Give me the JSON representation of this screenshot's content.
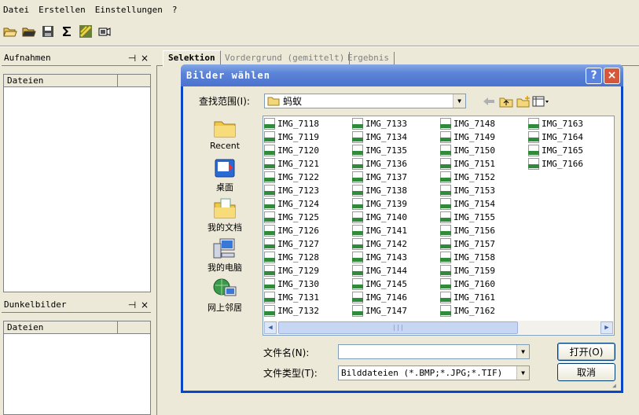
{
  "menu": [
    "Datei",
    "Erstellen",
    "Einstellungen",
    "?"
  ],
  "toolbar": {
    "icons": [
      "open-folder-icon",
      "open-folder-2-icon",
      "save-icon",
      "sigma-icon",
      "image-process-icon",
      "camera-icon"
    ]
  },
  "panels": {
    "top": {
      "title": "Aufnahmen",
      "pin": "ᵖ",
      "close": "×",
      "column": "Dateien"
    },
    "bottom": {
      "title": "Dunkelbilder",
      "pin": "ᵖ",
      "close": "×",
      "column": "Dateien"
    }
  },
  "tabs": [
    {
      "label": "Selektion",
      "active": true
    },
    {
      "label": "Vordergrund (gemittelt)",
      "active": false
    },
    {
      "label": "Ergebnis",
      "active": false
    }
  ],
  "dialog": {
    "title": "Bilder wählen",
    "help": "?",
    "close": "×",
    "lookin_label": "查找范围(I):",
    "lookin_value": "蚂蚁",
    "places": [
      {
        "label": "Recent",
        "icon": "recent-folder-icon"
      },
      {
        "label": "桌面",
        "icon": "desktop-icon"
      },
      {
        "label": "我的文档",
        "icon": "my-documents-icon"
      },
      {
        "label": "我的电脑",
        "icon": "my-computer-icon"
      },
      {
        "label": "网上邻居",
        "icon": "network-icon"
      }
    ],
    "files": [
      "IMG_7118",
      "IMG_7119",
      "IMG_7120",
      "IMG_7121",
      "IMG_7122",
      "IMG_7123",
      "IMG_7124",
      "IMG_7125",
      "IMG_7126",
      "IMG_7127",
      "IMG_7128",
      "IMG_7129",
      "IMG_7130",
      "IMG_7131",
      "IMG_7132",
      "IMG_7133",
      "IMG_7134",
      "IMG_7135",
      "IMG_7136",
      "IMG_7137",
      "IMG_7138",
      "IMG_7139",
      "IMG_7140",
      "IMG_7141",
      "IMG_7142",
      "IMG_7143",
      "IMG_7144",
      "IMG_7145",
      "IMG_7146",
      "IMG_7147",
      "IMG_7148",
      "IMG_7149",
      "IMG_7150",
      "IMG_7151",
      "IMG_7152",
      "IMG_7153",
      "IMG_7154",
      "IMG_7155",
      "IMG_7156",
      "IMG_7157",
      "IMG_7158",
      "IMG_7159",
      "IMG_7160",
      "IMG_7161",
      "IMG_7162",
      "IMG_7163",
      "IMG_7164",
      "IMG_7165",
      "IMG_7166"
    ],
    "filename_label": "文件名(N):",
    "filename_value": "",
    "filetype_label": "文件类型(T):",
    "filetype_value": "Bilddateien (*.BMP;*.JPG;*.TIF)",
    "open_button": "打开(O)",
    "cancel_button": "取消"
  }
}
